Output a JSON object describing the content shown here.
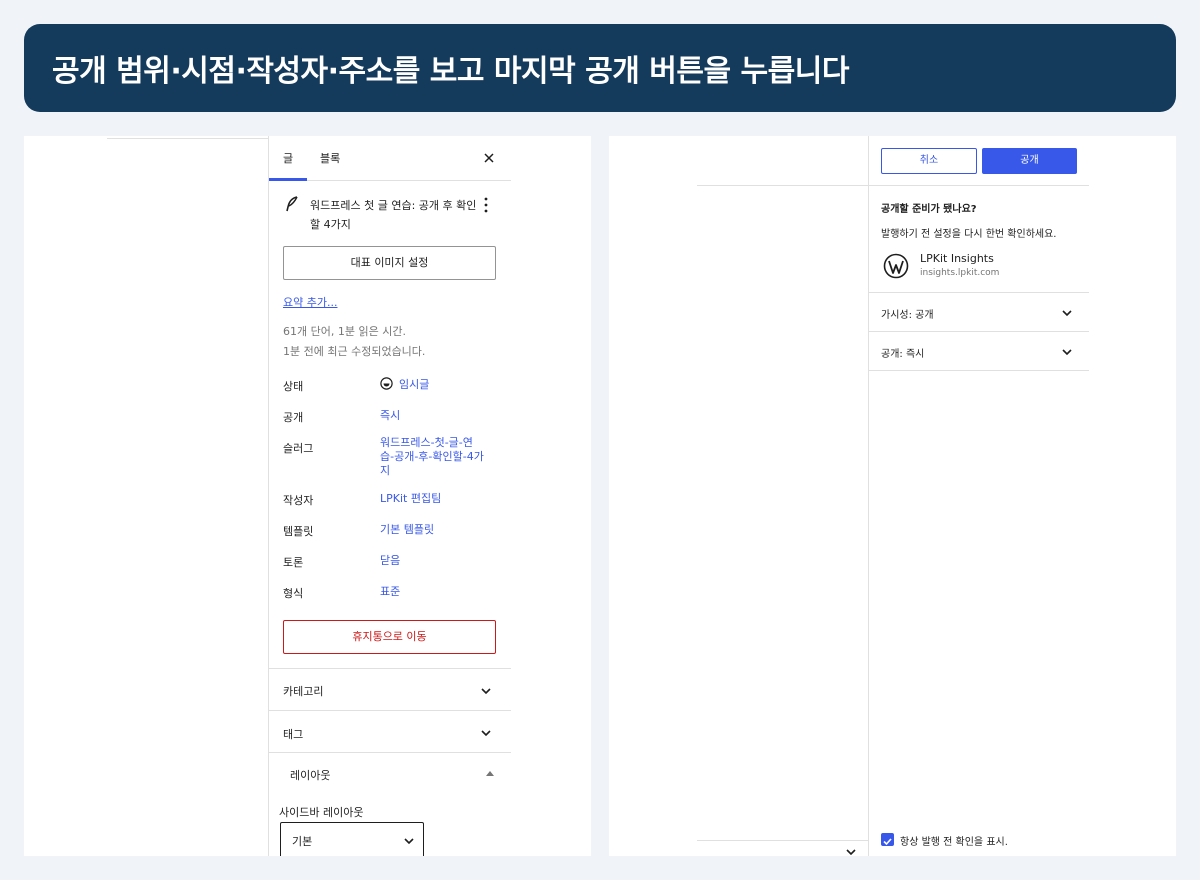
{
  "banner": {
    "title": "공개 범위·시점·작성자·주소를 보고 마지막 공개 버튼을 누릅니다"
  },
  "left": {
    "tabs": [
      {
        "label": "글"
      },
      {
        "label": "블록"
      }
    ],
    "close_icon": "close-icon",
    "post_title": "워드프레스 첫 글 연습: 공개 후 확인할 4가지",
    "featured_image_button": "대표 이미지 설정",
    "excerpt_link": "요약 추가...",
    "meta": {
      "words": "61개 단어, 1분 읽은 시간.",
      "modified": "1분 전에 최근 수정되었습니다."
    },
    "rows": [
      {
        "label": "상태",
        "value": "임시글"
      },
      {
        "label": "공개",
        "value": "즉시"
      },
      {
        "label": "슬러그",
        "value": "워드프레스-첫-글-연습-공개-후-확인할-4가지"
      },
      {
        "label": "작성자",
        "value": "LPKit 편집팀"
      },
      {
        "label": "템플릿",
        "value": "기본 템플릿"
      },
      {
        "label": "토론",
        "value": "닫음"
      },
      {
        "label": "형식",
        "value": "표준"
      }
    ],
    "trash_button": "휴지통으로 이동",
    "panels": {
      "categories": "카테고리",
      "tags": "태그",
      "layout": "레이아웃"
    },
    "layout_sub_label": "사이드바 레이아웃",
    "layout_select_value": "기본"
  },
  "right": {
    "cancel_button": "취소",
    "publish_button": "공개",
    "ready_title": "공개할 준비가 됐나요?",
    "ready_desc": "발행하기 전 설정을 다시 한번 확인하세요.",
    "site": {
      "name": "LPKit Insights",
      "url": "insights.lpkit.com"
    },
    "visibility_row": "가시성: 공개",
    "publish_row": "공개: 즉시",
    "always_show_check": "항상 발행 전 확인을 표시."
  },
  "colors": {
    "banner": "#143a5c",
    "accent": "#3858e9",
    "danger": "#cc1818",
    "background": "#f0f4f8"
  }
}
